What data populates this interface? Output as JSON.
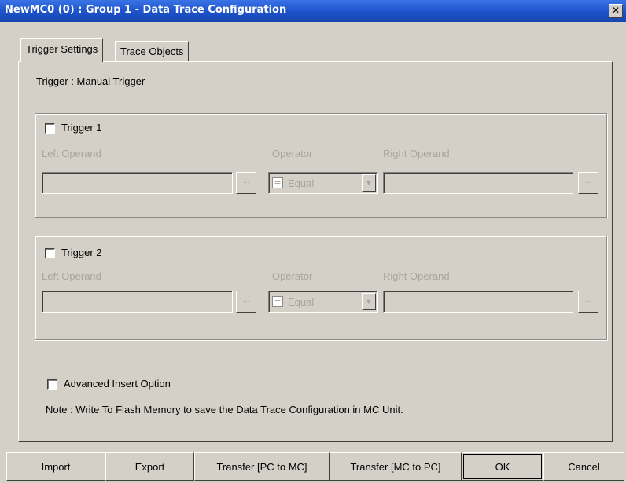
{
  "window": {
    "title": "NewMC0 (0) : Group 1 - Data Trace Configuration",
    "close_icon": "close-icon"
  },
  "tabs": [
    {
      "label": "Trigger Settings",
      "active": true
    },
    {
      "label": "Trace Objects",
      "active": false
    }
  ],
  "trigger_mode": "Trigger : Manual Trigger",
  "triggers": [
    {
      "label": "Trigger 1",
      "checked": false,
      "left_operand_label": "Left Operand",
      "left_operand_value": "",
      "operator_label": "Operator",
      "operator_value": "Equal",
      "operator_icon": "=",
      "right_operand_label": "Right Operand",
      "right_operand_value": "",
      "browse_label": "..."
    },
    {
      "label": "Trigger 2",
      "checked": false,
      "left_operand_label": "Left Operand",
      "left_operand_value": "",
      "operator_label": "Operator",
      "operator_value": "Equal",
      "operator_icon": "=",
      "right_operand_label": "Right Operand",
      "right_operand_value": "",
      "browse_label": "..."
    }
  ],
  "advanced_option": {
    "label": "Advanced Insert Option",
    "checked": false
  },
  "note": "Note : Write To Flash Memory to save the Data Trace Configuration in MC Unit.",
  "buttons": {
    "import": "Import",
    "export": "Export",
    "transfer_pc_to_mc": "Transfer [PC to MC]",
    "transfer_mc_to_pc": "Transfer [MC to PC]",
    "ok": "OK",
    "cancel": "Cancel"
  },
  "colors": {
    "titlebar": "#1e54cc",
    "dialog": "#d4d0c8",
    "disabled_text": "#a8a59e"
  }
}
